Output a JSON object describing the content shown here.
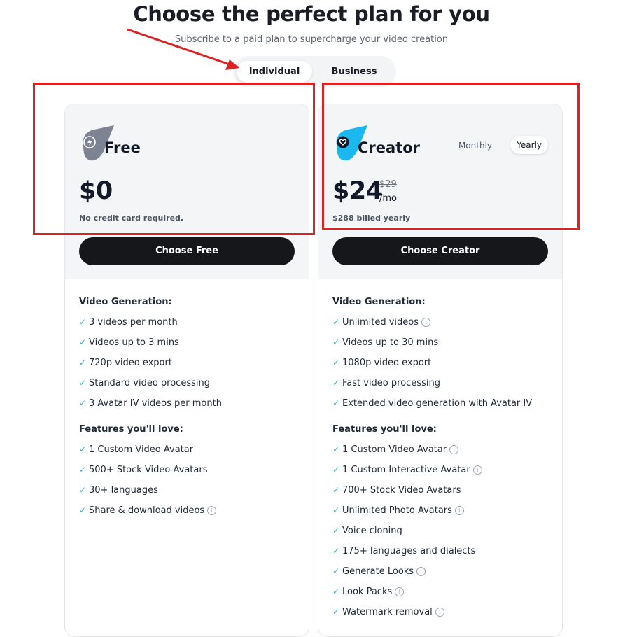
{
  "header": {
    "title": "Choose the perfect plan for you",
    "subtitle": "Subscribe to a paid plan to supercharge your video creation"
  },
  "plan_type_toggle": {
    "options": [
      "Individual",
      "Business"
    ],
    "selected": "Individual"
  },
  "plans": [
    {
      "name": "Free",
      "icon": "lightning-icon",
      "price": "$0",
      "note": "No credit card required.",
      "cta": "Choose Free",
      "sections": [
        {
          "title": "Video Generation:",
          "features": [
            {
              "text": "3 videos per month",
              "info": false
            },
            {
              "text": "Videos up to 3 mins",
              "info": false
            },
            {
              "text": "720p video export",
              "info": false
            },
            {
              "text": "Standard video processing",
              "info": false
            },
            {
              "text": "3 Avatar IV videos per month",
              "info": false
            }
          ]
        },
        {
          "title": "Features you'll love:",
          "features": [
            {
              "text": "1 Custom Video Avatar",
              "info": false
            },
            {
              "text": "500+ Stock Video Avatars",
              "info": false
            },
            {
              "text": "30+ languages",
              "info": false
            },
            {
              "text": "Share & download videos",
              "info": true
            }
          ]
        }
      ]
    },
    {
      "name": "Creator",
      "icon": "heart-icon",
      "price": "$24",
      "old_price": "$29",
      "period": "/mo",
      "note": "$288 billed yearly",
      "billing_options": [
        "Monthly",
        "Yearly"
      ],
      "billing_selected": "Yearly",
      "cta": "Choose Creator",
      "sections": [
        {
          "title": "Video Generation:",
          "features": [
            {
              "text": "Unlimited videos",
              "info": true
            },
            {
              "text": "Videos up to 30 mins",
              "info": false
            },
            {
              "text": "1080p video export",
              "info": false
            },
            {
              "text": "Fast video processing",
              "info": false
            },
            {
              "text": "Extended video generation with Avatar IV",
              "info": false
            }
          ]
        },
        {
          "title": "Features you'll love:",
          "features": [
            {
              "text": "1 Custom Video Avatar",
              "info": true
            },
            {
              "text": "1 Custom Interactive Avatar",
              "info": true
            },
            {
              "text": "700+ Stock Video Avatars",
              "info": false
            },
            {
              "text": "Unlimited Photo Avatars",
              "info": true
            },
            {
              "text": "Voice cloning",
              "info": false
            },
            {
              "text": "175+ languages and dialects",
              "info": false
            },
            {
              "text": "Generate Looks",
              "info": true
            },
            {
              "text": "Look Packs",
              "info": true
            },
            {
              "text": "Watermark removal",
              "info": true
            }
          ]
        }
      ]
    }
  ],
  "colors": {
    "accent": "#22b8e6",
    "free_logo": "#7d8392",
    "creator_logo": "#1ab8ee",
    "cta_bg": "#16171b",
    "annotation": "#dd2222"
  }
}
